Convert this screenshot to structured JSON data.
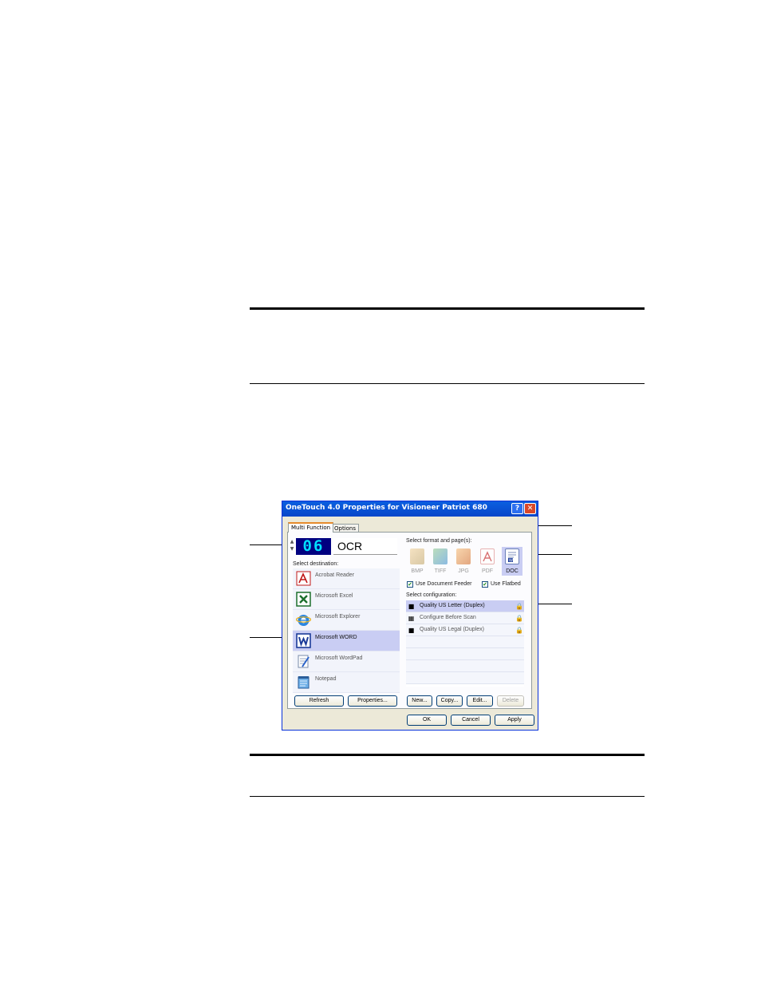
{
  "dialog": {
    "title": "OneTouch 4.0 Properties for Visioneer Patriot 680",
    "help_label": "?",
    "close_label": "✕",
    "tabs": [
      {
        "label": "Multi Function"
      },
      {
        "label": "Options"
      }
    ],
    "button_number": "06",
    "function_name": "OCR",
    "select_destination_label": "Select destination:",
    "destinations": [
      {
        "label": "Acrobat Reader",
        "icon": "acrobat-reader-icon"
      },
      {
        "label": "Microsoft Excel",
        "icon": "excel-icon"
      },
      {
        "label": "Microsoft Explorer",
        "icon": "internet-explorer-icon"
      },
      {
        "label": "Microsoft WORD",
        "icon": "word-icon",
        "selected": true
      },
      {
        "label": "Microsoft WordPad",
        "icon": "wordpad-icon"
      },
      {
        "label": "Notepad",
        "icon": "notepad-icon"
      }
    ],
    "refresh_label": "Refresh",
    "properties_label": "Properties...",
    "select_format_label": "Select format and page(s):",
    "formats": [
      {
        "label": "BMP"
      },
      {
        "label": "TIFF"
      },
      {
        "label": "JPG"
      },
      {
        "label": "PDF"
      },
      {
        "label": "DOC",
        "selected": true
      }
    ],
    "use_document_feeder_label": "Use Document Feeder",
    "use_flatbed_label": "Use Flatbed",
    "use_document_feeder_checked": true,
    "use_flatbed_checked": true,
    "select_configuration_label": "Select configuration:",
    "configurations": [
      {
        "label": "Quality US Letter (Duplex)",
        "selected": true
      },
      {
        "label": "Configure Before Scan"
      },
      {
        "label": "Quality US Legal (Duplex)"
      }
    ],
    "new_label": "New...",
    "copy_label": "Copy...",
    "edit_label": "Edit...",
    "delete_label": "Delete",
    "ok_label": "OK",
    "cancel_label": "Cancel",
    "apply_label": "Apply"
  },
  "colors": {
    "titlebar": "#0a5fe0",
    "selection": "#c9cdf3",
    "dialog_face": "#ece9d8",
    "lcd_background": "#000080",
    "lcd_digits": "#00e0ff"
  }
}
